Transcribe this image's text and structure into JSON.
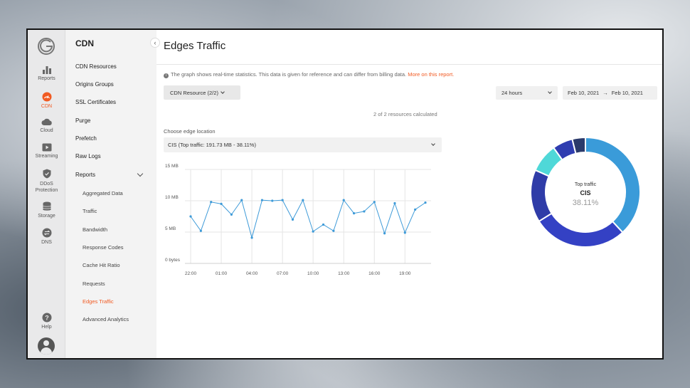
{
  "brand": {
    "accent": "#f15a22",
    "logo_icon": "gcore-logo"
  },
  "iconbar": {
    "items": [
      {
        "label": "Reports",
        "icon": "bar-chart-icon"
      },
      {
        "label": "CDN",
        "icon": "cdn-speed-icon",
        "active": true
      },
      {
        "label": "Cloud",
        "icon": "cloud-icon"
      },
      {
        "label": "Streaming",
        "icon": "play-icon"
      },
      {
        "label": "DDoS Protection",
        "icon": "shield-icon"
      },
      {
        "label": "Storage",
        "icon": "database-icon"
      },
      {
        "label": "DNS",
        "icon": "dns-icon"
      }
    ],
    "help": "Help"
  },
  "sidebar": {
    "title": "CDN",
    "items": [
      "CDN Resources",
      "Origins Groups",
      "SSL Certificates",
      "Purge",
      "Prefetch",
      "Raw Logs",
      "Reports"
    ],
    "reports_sub": [
      "Aggregated Data",
      "Traffic",
      "Bandwidth",
      "Response Codes",
      "Cache Hit Ratio",
      "Requests",
      "Edges Traffic",
      "Advanced Analytics"
    ],
    "active_sub": "Edges Traffic"
  },
  "page": {
    "title": "Edges Traffic",
    "info_text": "The graph shows real-time statistics. This data is given for reference and can differ from billing data.",
    "info_link": "More on this report.",
    "resource_button": "CDN Resource (2/2)",
    "range": "24 hours",
    "date_from": "Feb 10, 2021",
    "date_to": "Feb 10, 2021",
    "calculated": "2 of 2 resources calculated",
    "location_label": "Choose edge location",
    "location_value": "CIS (Top traffic: 191.73 MB - 38.11%)"
  },
  "chart_data": [
    {
      "type": "line",
      "y_ticks": [
        "15 MB",
        "10 MB",
        "5 MB",
        "0 bytes"
      ],
      "ylim": [
        0,
        15
      ],
      "x_ticks": [
        "22:00",
        "01:00",
        "04:00",
        "07:00",
        "10:00",
        "13:00",
        "16:00",
        "19:00"
      ],
      "grid": true,
      "color": "#3d9ad8",
      "series": [
        {
          "values": [
            7.5,
            5.2,
            9.8,
            9.5,
            7.8,
            10.1,
            4.1,
            10.1,
            10.0,
            10.1,
            7.0,
            10.1,
            5.1,
            6.2,
            5.2,
            10.1,
            8.0,
            8.3,
            9.8,
            4.8,
            9.6,
            4.9,
            8.6,
            9.7
          ]
        }
      ]
    },
    {
      "type": "pie",
      "center_label": "Top traffic",
      "center_name": "CIS",
      "center_value": "38.11%",
      "slices": [
        {
          "value": 38.11,
          "color": "#3a9bd9"
        },
        {
          "value": 28.0,
          "color": "#3441c4"
        },
        {
          "value": 15.5,
          "color": "#2f3ca8"
        },
        {
          "value": 8.5,
          "color": "#4fd8d8"
        },
        {
          "value": 6.0,
          "color": "#2f3db0"
        },
        {
          "value": 3.89,
          "color": "#2b3a6b"
        }
      ]
    }
  ]
}
